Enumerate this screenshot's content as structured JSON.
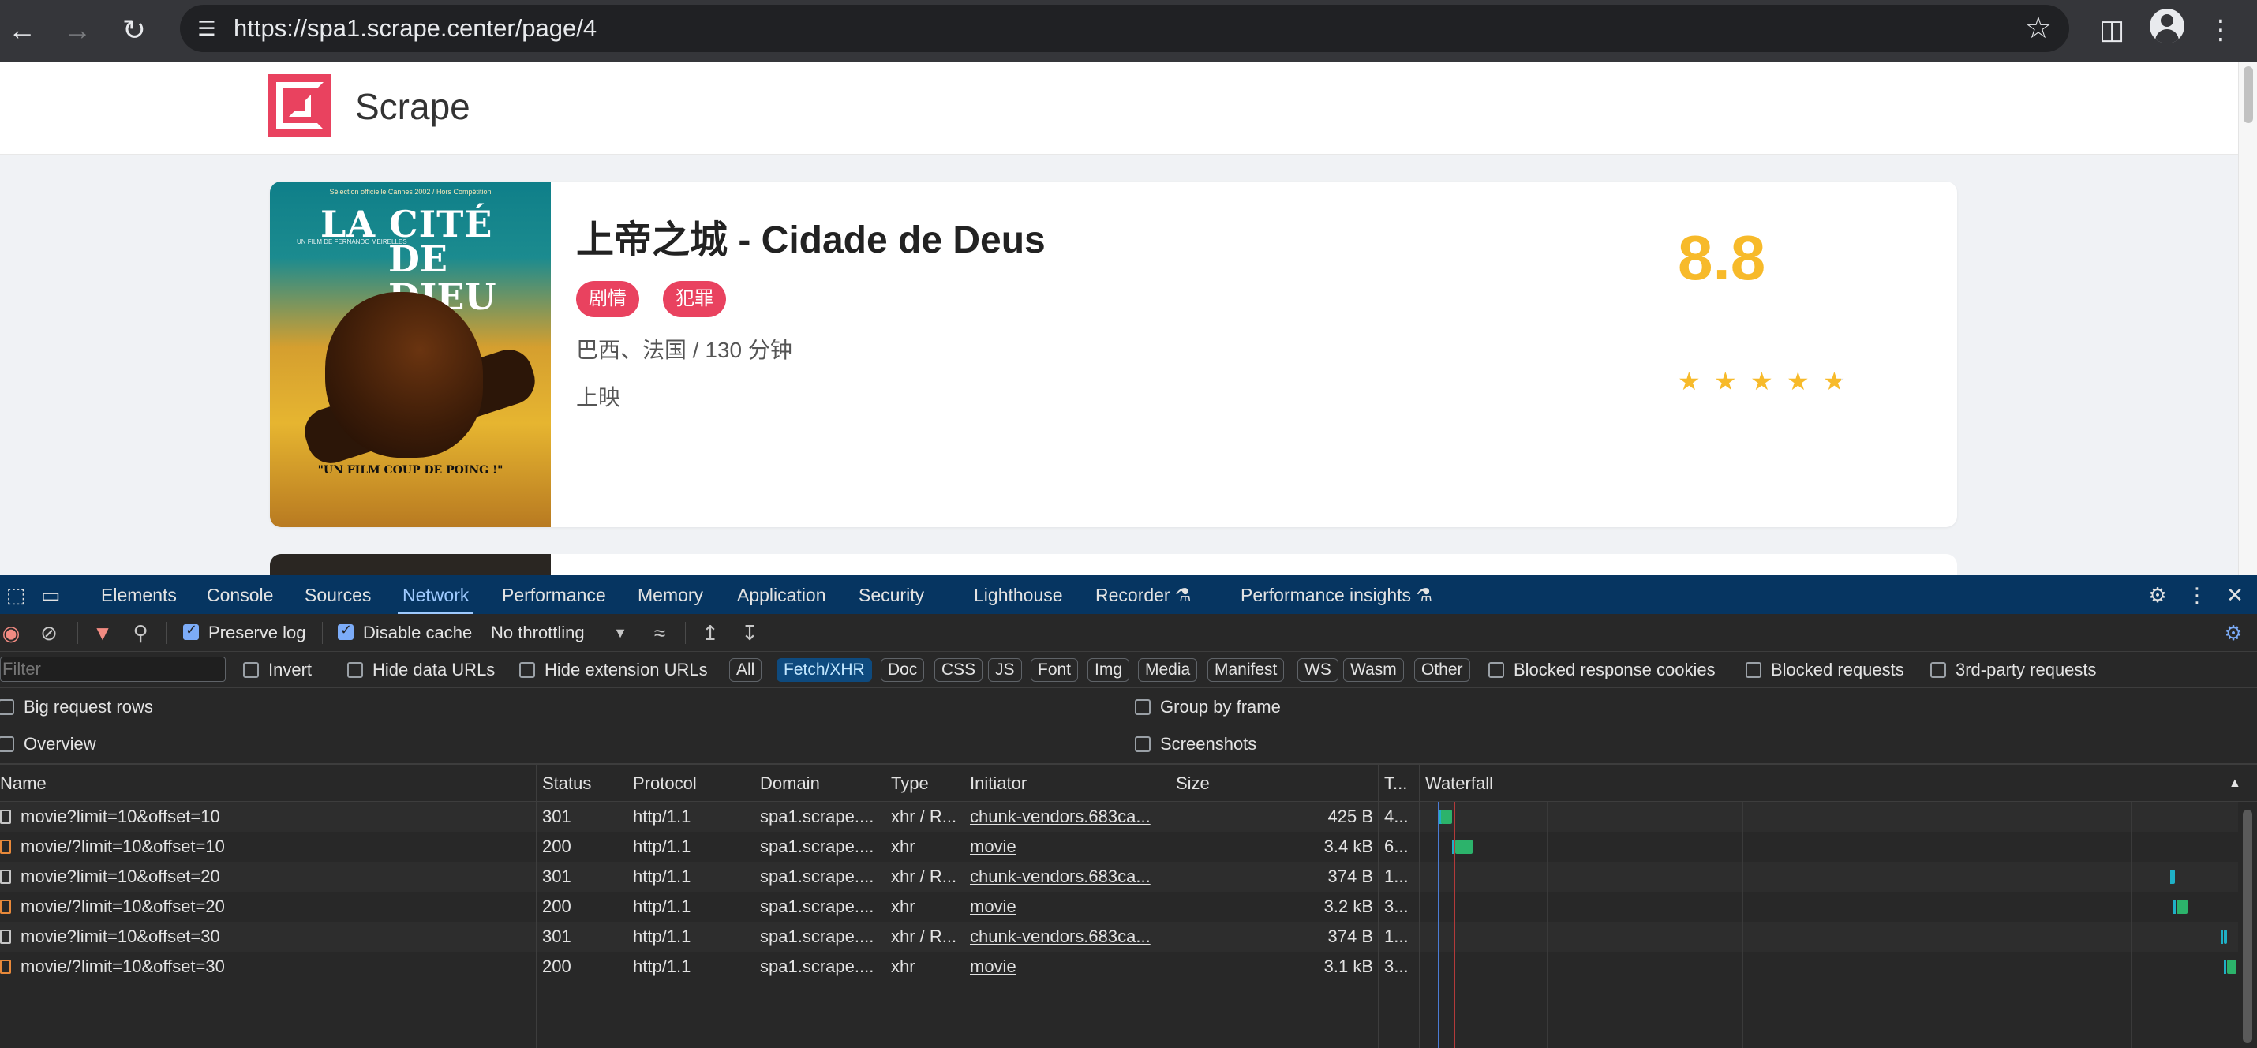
{
  "browser": {
    "url": "https://spa1.scrape.center/page/4",
    "icons": [
      "back-arrow-icon",
      "forward-arrow-icon",
      "reload-icon",
      "site-settings-icon",
      "star-icon",
      "side-panel-icon",
      "profile-icon",
      "more-icon"
    ]
  },
  "site": {
    "brand": "Scrape",
    "movie": {
      "title": "上帝之城 - Cidade de Deus",
      "tags": [
        "剧情",
        "犯罪"
      ],
      "meta": "巴西、法国 / 130 分钟",
      "status": "上映",
      "score": "8.8",
      "stars": 4.5,
      "poster_text": {
        "small": "Sélection officielle Cannes 2002 / Hors Compétition",
        "title_line1": "LA CITÉ",
        "title_line2": "DE DIEU",
        "director": "UN FILM DE FERNANDO MEIRELLES",
        "tagline": "\"UN FILM COUP DE POING !\""
      }
    },
    "colors": {
      "accent": "#e9425f",
      "score": "#f7ba2a"
    }
  },
  "devtools": {
    "tabs": [
      "Elements",
      "Console",
      "Sources",
      "Network",
      "Performance",
      "Memory",
      "Application",
      "Security",
      "Lighthouse",
      "Recorder",
      "Performance insights"
    ],
    "active_tab": "Network",
    "toolbar": {
      "preserve_log": "Preserve log",
      "disable_cache": "Disable cache",
      "throttling": "No throttling"
    },
    "filter": {
      "placeholder": "Filter",
      "invert": "Invert",
      "hide_data_urls": "Hide data URLs",
      "hide_extension_urls": "Hide extension URLs",
      "chips": [
        "All",
        "Fetch/XHR",
        "Doc",
        "CSS",
        "JS",
        "Font",
        "Img",
        "Media",
        "Manifest",
        "WS",
        "Wasm",
        "Other"
      ],
      "active_chip": "Fetch/XHR",
      "blocked_response_cookies": "Blocked response cookies",
      "blocked_requests": "Blocked requests",
      "third_party": "3rd-party requests"
    },
    "options": {
      "big_request_rows": "Big request rows",
      "overview": "Overview",
      "group_by_frame": "Group by frame",
      "screenshots": "Screenshots"
    },
    "columns": [
      "Name",
      "Status",
      "Protocol",
      "Domain",
      "Type",
      "Initiator",
      "Size",
      "T...",
      "Waterfall"
    ],
    "rows": [
      {
        "name": "movie?limit=10&offset=10",
        "status": "301",
        "protocol": "http/1.1",
        "domain": "spa1.scrape....",
        "type": "xhr / R...",
        "initiator": "chunk-vendors.683ca...",
        "size": "425 B",
        "time": "4...",
        "kind": "doc"
      },
      {
        "name": "movie/?limit=10&offset=10",
        "status": "200",
        "protocol": "http/1.1",
        "domain": "spa1.scrape....",
        "type": "xhr",
        "initiator": "movie",
        "size": "3.4 kB",
        "time": "6...",
        "kind": "xhr"
      },
      {
        "name": "movie?limit=10&offset=20",
        "status": "301",
        "protocol": "http/1.1",
        "domain": "spa1.scrape....",
        "type": "xhr / R...",
        "initiator": "chunk-vendors.683ca...",
        "size": "374 B",
        "time": "1...",
        "kind": "doc"
      },
      {
        "name": "movie/?limit=10&offset=20",
        "status": "200",
        "protocol": "http/1.1",
        "domain": "spa1.scrape....",
        "type": "xhr",
        "initiator": "movie",
        "size": "3.2 kB",
        "time": "3...",
        "kind": "xhr"
      },
      {
        "name": "movie?limit=10&offset=30",
        "status": "301",
        "protocol": "http/1.1",
        "domain": "spa1.scrape....",
        "type": "xhr / R...",
        "initiator": "chunk-vendors.683ca...",
        "size": "374 B",
        "time": "1...",
        "kind": "doc"
      },
      {
        "name": "movie/?limit=10&offset=30",
        "status": "200",
        "protocol": "http/1.1",
        "domain": "spa1.scrape....",
        "type": "xhr",
        "initiator": "movie",
        "size": "3.1 kB",
        "time": "3...",
        "kind": "xhr"
      }
    ]
  }
}
